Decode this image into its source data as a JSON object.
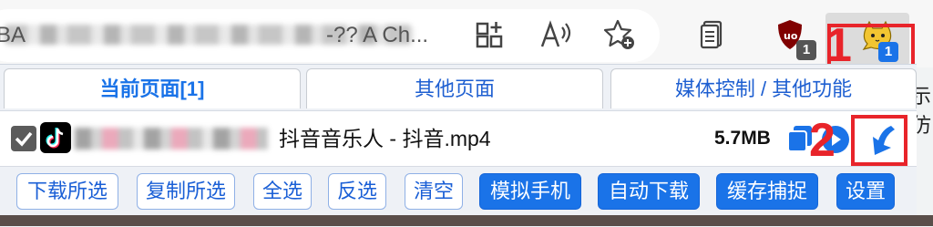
{
  "browser": {
    "url_partial": "ABA",
    "url_suffix": "-?? A Ch...",
    "badges": {
      "ublock_count": "1",
      "extension_count": "1"
    },
    "icons": [
      "split-screen-icon",
      "read-aloud-icon",
      "add-favorite-icon",
      "collections-icon",
      "ublock-icon",
      "cat-extension-icon"
    ]
  },
  "annotations": {
    "one": "1",
    "two": "2"
  },
  "tabs": [
    "当前页面[1]",
    "其他页面",
    "媒体控制 / 其他功能"
  ],
  "file": {
    "name": "抖音音乐人 - 抖音.mp4",
    "size": "5.7MB",
    "checked": true
  },
  "buttons": {
    "download_selected": "下载所选",
    "copy_selected": "复制所选",
    "select_all": "全选",
    "invert": "反选",
    "clear": "清空",
    "simulate_phone": "模拟手机",
    "auto_download": "自动下载",
    "cache_capture": "缓存捕捉",
    "settings": "设置"
  },
  "side_text": "示仿",
  "colors": {
    "accent": "#1a73e8",
    "annotation": "#e8242a"
  }
}
